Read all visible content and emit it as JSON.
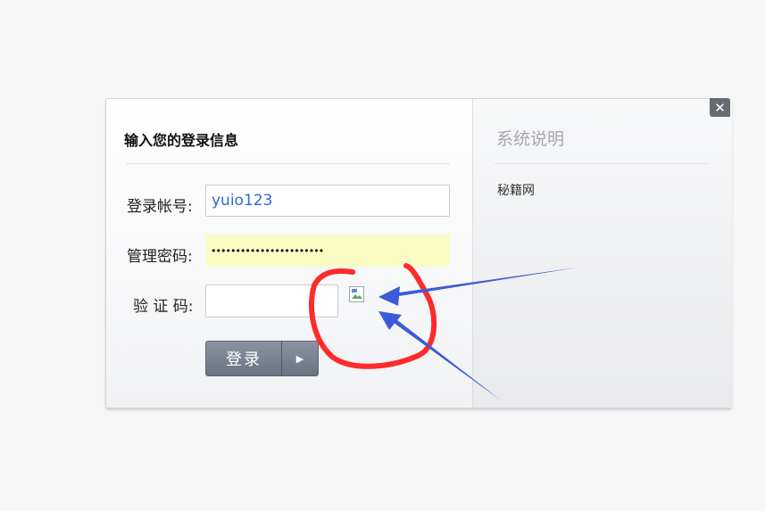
{
  "login": {
    "title": "输入您的登录信息",
    "account_label": "登录帐号:",
    "account_value": "yuio123",
    "password_label": "管理密码:",
    "password_value": "•••••••••••••••••••••••",
    "captcha_label": "验 证 码:",
    "captcha_value": "",
    "submit_label": "登录",
    "submit_arrow": "▶"
  },
  "info": {
    "title": "系统说明",
    "text": "秘籍网"
  },
  "close_icon": "✕",
  "colors": {
    "annotation_circle": "#ff2a2a",
    "annotation_arrow": "#3c5bd6",
    "password_bg": "#fafcc4",
    "account_text": "#2b6bd6"
  }
}
